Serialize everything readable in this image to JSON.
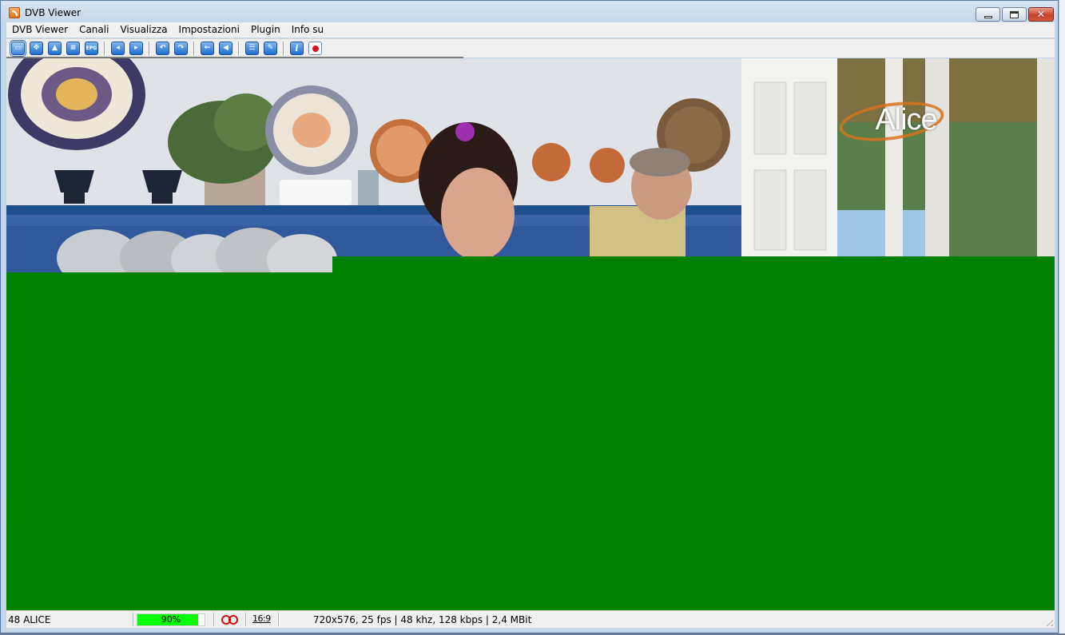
{
  "window": {
    "title": "DVB Viewer",
    "controls": {
      "minimize": "minimize",
      "maximize": "maximize",
      "close": "✕"
    }
  },
  "menu": [
    "DVB Viewer",
    "Canali",
    "Visualizza",
    "Impostazioni",
    "Plugin",
    "Info su"
  ],
  "toolbar": {
    "groups": [
      [
        "fullscreen-icon",
        "move-icon",
        "picture-icon",
        "list-icon",
        "epg-icon"
      ],
      [
        "channel-prev-icon",
        "channel-next-icon"
      ],
      [
        "back-icon",
        "forward-icon"
      ],
      [
        "left-arrow-icon",
        "volume-icon"
      ],
      [
        "channel-list-icon",
        "settings-icon"
      ],
      [
        "info-icon",
        "record-icon"
      ]
    ],
    "epg_label": "EPG"
  },
  "video": {
    "channel_logo": "Alice",
    "background_color": "#008000"
  },
  "status": {
    "channel": "48 ALICE",
    "signal_text": "90%",
    "signal_fraction": 0.9,
    "aspect": "16:9",
    "stream_info": "720x576, 25 fps | 48 khz, 128 kbps | 2,4 MBit"
  },
  "colors": {
    "signal": "#00ff00",
    "video_green": "#008000",
    "close_button": "#c7412a"
  }
}
